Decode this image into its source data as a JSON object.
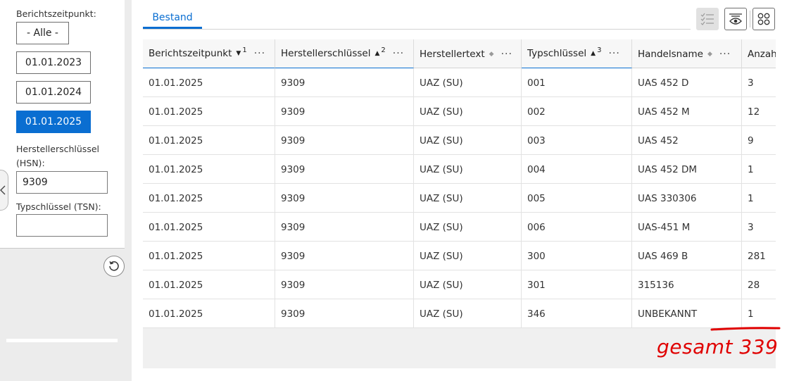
{
  "filters": {
    "date_label": "Berichtszeitpunkt:",
    "date_options": [
      "- Alle -",
      "01.01.2023",
      "01.01.2024",
      "01.01.2025"
    ],
    "selected_option": "01.01.2025",
    "hsn_label_line1": "Herstellerschlüssel",
    "hsn_label_line2": "(HSN):",
    "hsn_value": "9309",
    "tsn_label": "Typschlüssel (TSN):",
    "tsn_value": ""
  },
  "tabs": [
    "Bestand"
  ],
  "toolbar": {
    "icons": [
      "checklist-icon",
      "eye-filter-icon",
      "grid-icon"
    ]
  },
  "table": {
    "columns": [
      {
        "label": "Berichtszeitpunkt",
        "sort": "desc",
        "sort_order": "1"
      },
      {
        "label": "Herstellerschlüssel",
        "sort": "asc",
        "sort_order": "2"
      },
      {
        "label": "Herstellertext",
        "sort": "none",
        "sort_order": ""
      },
      {
        "label": "Typschlüssel",
        "sort": "asc",
        "sort_order": "3"
      },
      {
        "label": "Handelsname",
        "sort": "none",
        "sort_order": ""
      },
      {
        "label": "Anzah",
        "sort": "none",
        "sort_order": ""
      }
    ],
    "rows": [
      [
        "01.01.2025",
        "9309",
        "UAZ (SU)",
        "001",
        "UAS 452 D",
        "3"
      ],
      [
        "01.01.2025",
        "9309",
        "UAZ (SU)",
        "002",
        "UAS 452 M",
        "12"
      ],
      [
        "01.01.2025",
        "9309",
        "UAZ (SU)",
        "003",
        "UAS 452",
        "9"
      ],
      [
        "01.01.2025",
        "9309",
        "UAZ (SU)",
        "004",
        "UAS 452 DM",
        "1"
      ],
      [
        "01.01.2025",
        "9309",
        "UAZ (SU)",
        "005",
        "UAS 330306",
        "1"
      ],
      [
        "01.01.2025",
        "9309",
        "UAZ (SU)",
        "006",
        "UAS-451 M",
        "3"
      ],
      [
        "01.01.2025",
        "9309",
        "UAZ (SU)",
        "300",
        "UAS 469 B",
        "281"
      ],
      [
        "01.01.2025",
        "9309",
        "UAZ (SU)",
        "301",
        "315136",
        "28"
      ],
      [
        "01.01.2025",
        "9309",
        "UAZ (SU)",
        "346",
        "UNBEKANNT",
        "1"
      ]
    ]
  },
  "annotation": {
    "text": "gesamt 339",
    "color": "#e00000"
  }
}
